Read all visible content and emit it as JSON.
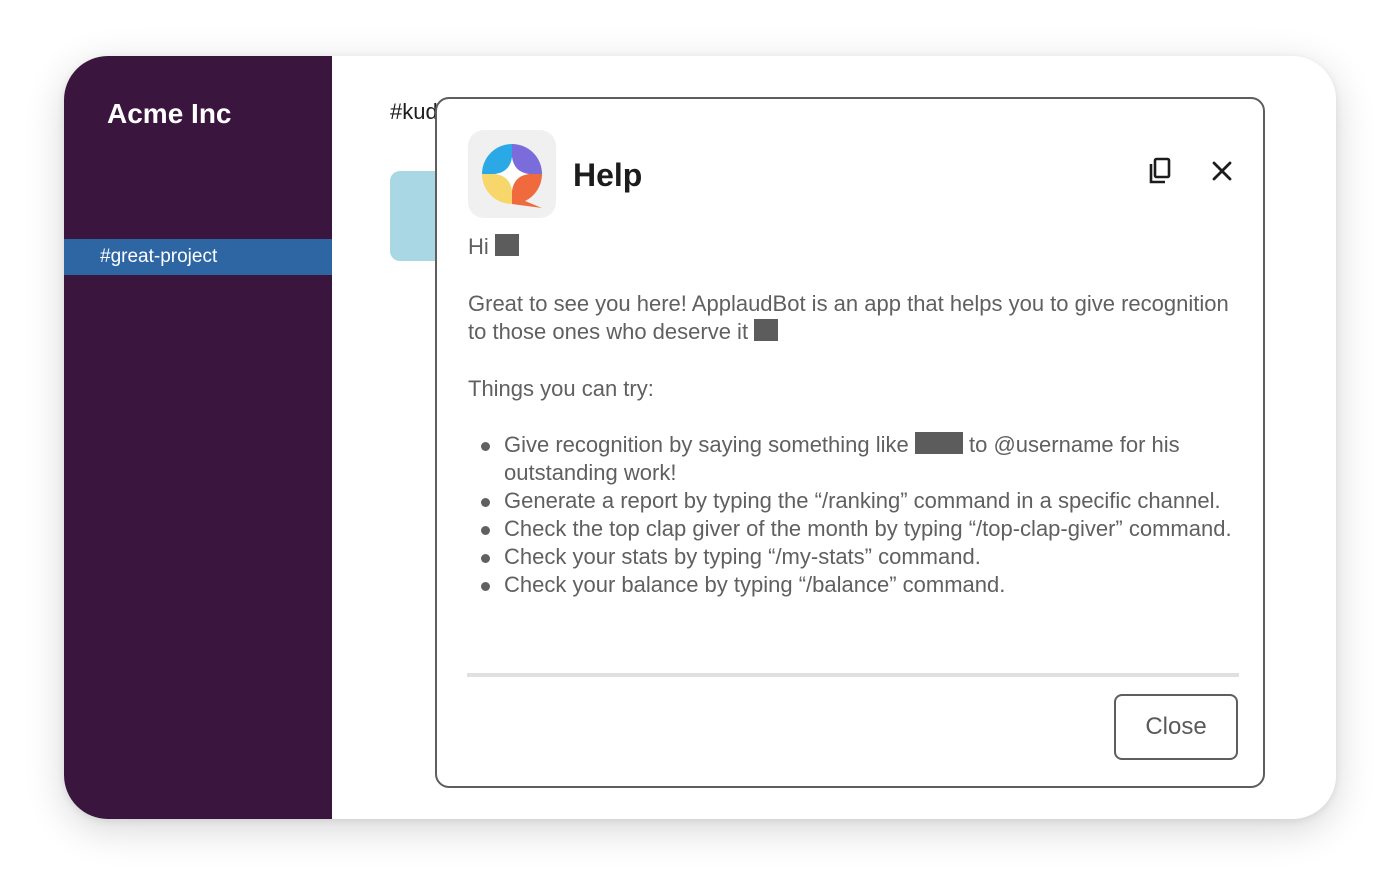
{
  "sidebar": {
    "workspace_name": "Acme Inc",
    "channels": [
      {
        "label": "#great-project",
        "selected": true
      }
    ]
  },
  "main": {
    "channel_title": "#kud"
  },
  "modal": {
    "title": "Help",
    "app_icon": "applaudbot-logo",
    "copy_icon": "copy-icon",
    "close_icon": "close-icon",
    "greeting": "Hi",
    "intro": "Great to see you here! ApplaudBot is an app that helps you to give recognition to those ones who deserve it",
    "things_heading": "Things you can try:",
    "bullets": [
      {
        "before": "Give recognition by saying something like",
        "after": "to @username for his outstanding work!"
      },
      {
        "text": "Generate a report by typing the “/ranking” command in a specific channel."
      },
      {
        "text": "Check the top clap giver of the month by typing “/top-clap-giver” command."
      },
      {
        "text": "Check your stats by typing “/my-stats” command."
      },
      {
        "text": "Check your balance by typing “/balance” command."
      }
    ],
    "close_button_label": "Close"
  },
  "colors": {
    "sidebar_bg": "#3a153d",
    "selected_channel_bg": "#2e65a3",
    "modal_border": "#5e5e5e",
    "body_text": "#606060",
    "message_block": "#a9d8e4"
  }
}
